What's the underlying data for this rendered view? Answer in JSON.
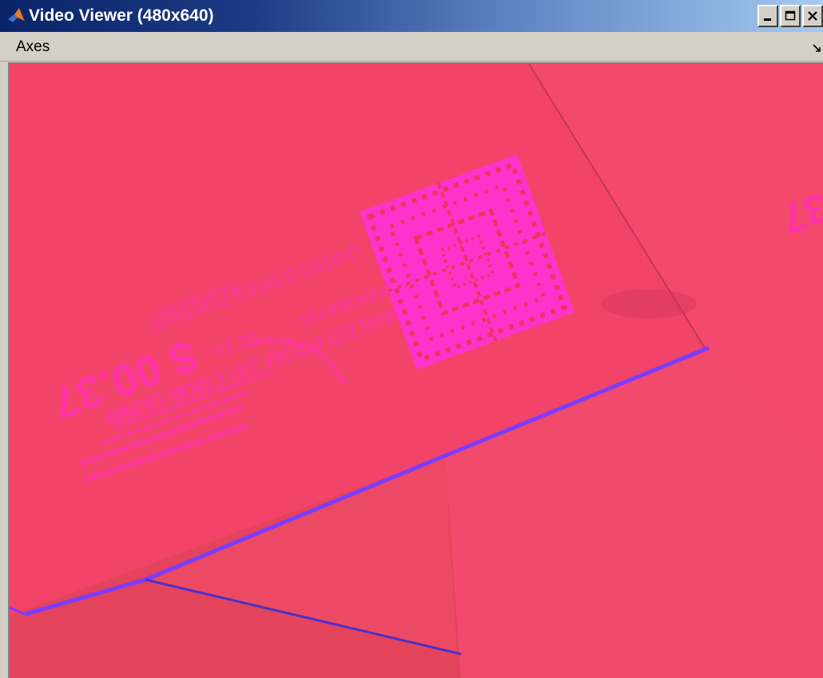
{
  "window": {
    "title": "Video Viewer (480x640)"
  },
  "menu": {
    "items": [
      {
        "label": "Axes"
      }
    ]
  },
  "frame": {
    "postage_text": {
      "ring_top": "UNITED STATES POSTAGE",
      "mailed_from": "MAILED FROM ZIP CODE 01760",
      "meter_number": "0004384734",
      "date": "AUG 19 2005",
      "amount": "$ 00.37",
      "code": "02 1A",
      "brand": "PITNEY BOWES",
      "partial_amount": "37",
      "partial_zip": "01760",
      "partial_year": "2005"
    }
  }
}
